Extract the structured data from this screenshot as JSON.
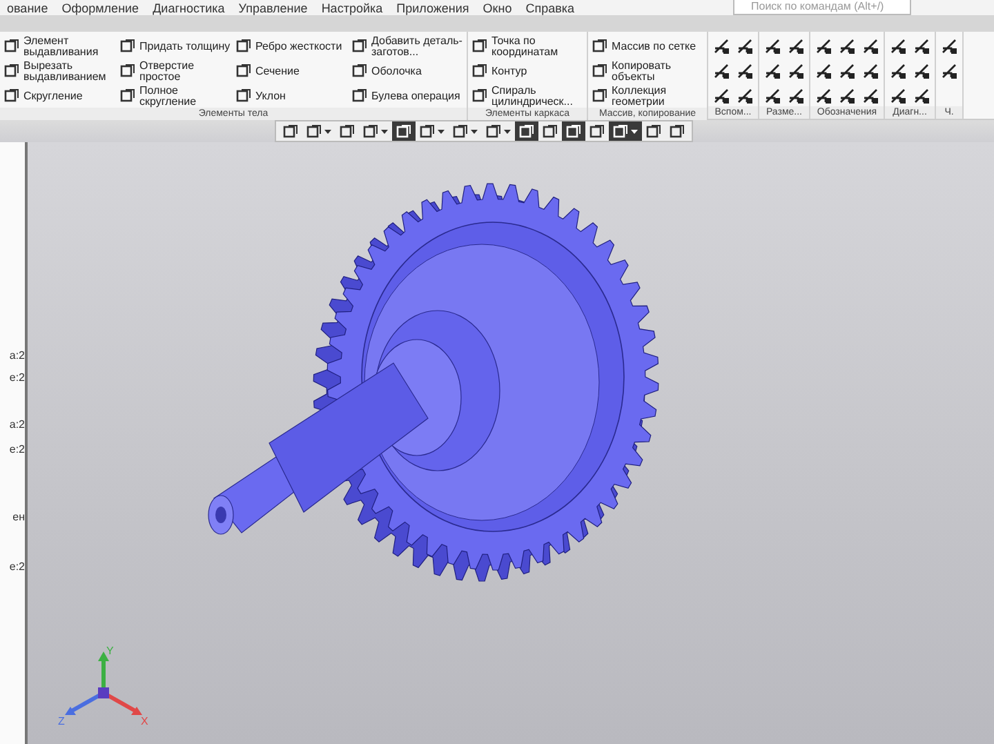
{
  "menu_bar": [
    "ование",
    "Оформление",
    "Диагностика",
    "Управление",
    "Настройка",
    "Приложения",
    "Окно",
    "Справка"
  ],
  "search": {
    "placeholder": "Поиск по командам (Alt+/)"
  },
  "ribbon": {
    "groups": [
      {
        "kind": "labeled",
        "label": "Элементы тела",
        "columns": [
          [
            "Элемент выдавливания",
            "Вырезать выдавливанием",
            "Скругление"
          ],
          [
            "Придать толщину",
            "Отверстие простое",
            "Полное скругление"
          ],
          [
            "Ребро жесткости",
            "Сечение",
            "Уклон"
          ],
          [
            "Добавить деталь-заготов...",
            "Оболочка",
            "Булева операция"
          ]
        ]
      },
      {
        "kind": "labeled",
        "label": "Элементы каркаса",
        "columns": [
          [
            "Точка по координатам",
            "Контур",
            "Спираль цилиндрическ..."
          ]
        ]
      },
      {
        "kind": "labeled",
        "label": "Массив, копирование",
        "columns": [
          [
            "Массив по сетке",
            "Копировать объекты",
            "Коллекция геометрии"
          ]
        ]
      },
      {
        "kind": "icons",
        "label": "Вспом..."
      },
      {
        "kind": "icons",
        "label": "Разме..."
      },
      {
        "kind": "icons",
        "label": "Обозначения"
      },
      {
        "kind": "icons",
        "label": "Диагн..."
      },
      {
        "kind": "icons",
        "label": "Ч."
      }
    ]
  },
  "view_toolbar": [
    {
      "selected": false,
      "dropdown": false
    },
    {
      "selected": false,
      "dropdown": true
    },
    {
      "selected": false,
      "dropdown": false
    },
    {
      "selected": false,
      "dropdown": true
    },
    {
      "selected": true,
      "dropdown": false
    },
    {
      "selected": false,
      "dropdown": true
    },
    {
      "selected": false,
      "dropdown": true
    },
    {
      "selected": false,
      "dropdown": true
    },
    {
      "selected": true,
      "dropdown": false
    },
    {
      "selected": false,
      "dropdown": false
    },
    {
      "selected": true,
      "dropdown": false
    },
    {
      "selected": false,
      "dropdown": false
    },
    {
      "selected": true,
      "dropdown": true
    },
    {
      "selected": false,
      "dropdown": false
    },
    {
      "selected": false,
      "dropdown": false
    }
  ],
  "tree_fragments": [
    "а:2",
    "е:2",
    "а:2",
    "е:2",
    "ен",
    "е:2"
  ],
  "axes": [
    "Y",
    "Z",
    "X"
  ]
}
